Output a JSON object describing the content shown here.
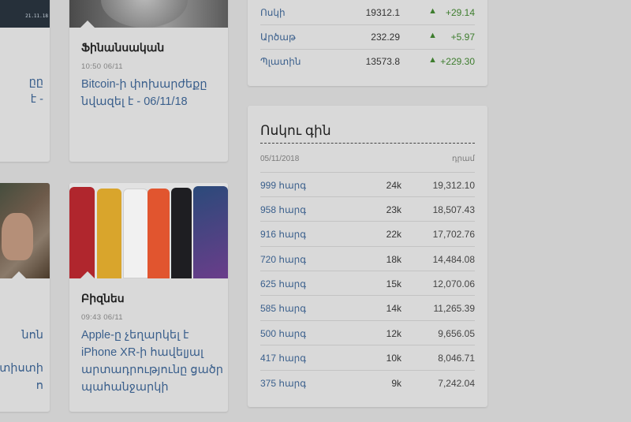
{
  "left_partial": {
    "top_label": "21.11.18",
    "text_top": [
      "ըը",
      "է -"
    ],
    "text_bottom": [
      "նոն",
      "տիստի",
      "ո"
    ]
  },
  "articles": [
    {
      "category": "Ֆինանսական",
      "time": "10:50 06/11",
      "title_lines": [
        "Bitcoin-ի փոխարժեքը",
        "նվազել է - 06/11/18"
      ]
    },
    {
      "category": "Բիզնես",
      "time": "09:43 06/11",
      "title_lines": [
        "Apple-ը չեղարկել է",
        "iPhone XR-ի հավելյալ",
        "արտադրությունը ցածր",
        "պահանջարկի"
      ]
    }
  ],
  "metals": [
    {
      "name": "Ոսկի",
      "value": "19312.1",
      "arrow": "▲",
      "change": "+29.14"
    },
    {
      "name": "Արծաթ",
      "value": "232.29",
      "arrow": "▲",
      "change": "+5.97"
    },
    {
      "name": "Պլատին",
      "value": "13573.8",
      "arrow": "▲",
      "change": "+229.30"
    }
  ],
  "gold": {
    "title": "Ոսկու գին",
    "date": "05/11/2018",
    "unit": "դրամ",
    "rows": [
      {
        "purity": "999 հարգ",
        "karat": "24k",
        "price": "19,312.10"
      },
      {
        "purity": "958 հարգ",
        "karat": "23k",
        "price": "18,507.43"
      },
      {
        "purity": "916 հարգ",
        "karat": "22k",
        "price": "17,702.76"
      },
      {
        "purity": "720 հարգ",
        "karat": "18k",
        "price": "14,484.08"
      },
      {
        "purity": "625 հարգ",
        "karat": "15k",
        "price": "12,070.06"
      },
      {
        "purity": "585 հարգ",
        "karat": "14k",
        "price": "11,265.39"
      },
      {
        "purity": "500 հարգ",
        "karat": "12k",
        "price": "9,656.05"
      },
      {
        "purity": "417 հարգ",
        "karat": "10k",
        "price": "8,046.71"
      },
      {
        "purity": "375 հարգ",
        "karat": "9k",
        "price": "7,242.04"
      }
    ]
  },
  "colors": {
    "background": "#cfcfcf",
    "card": "#d9d9d9",
    "link": "#3a5f8c",
    "positive": "#3e7d2e"
  },
  "icons": {
    "up_arrow": "up-arrow-icon"
  }
}
